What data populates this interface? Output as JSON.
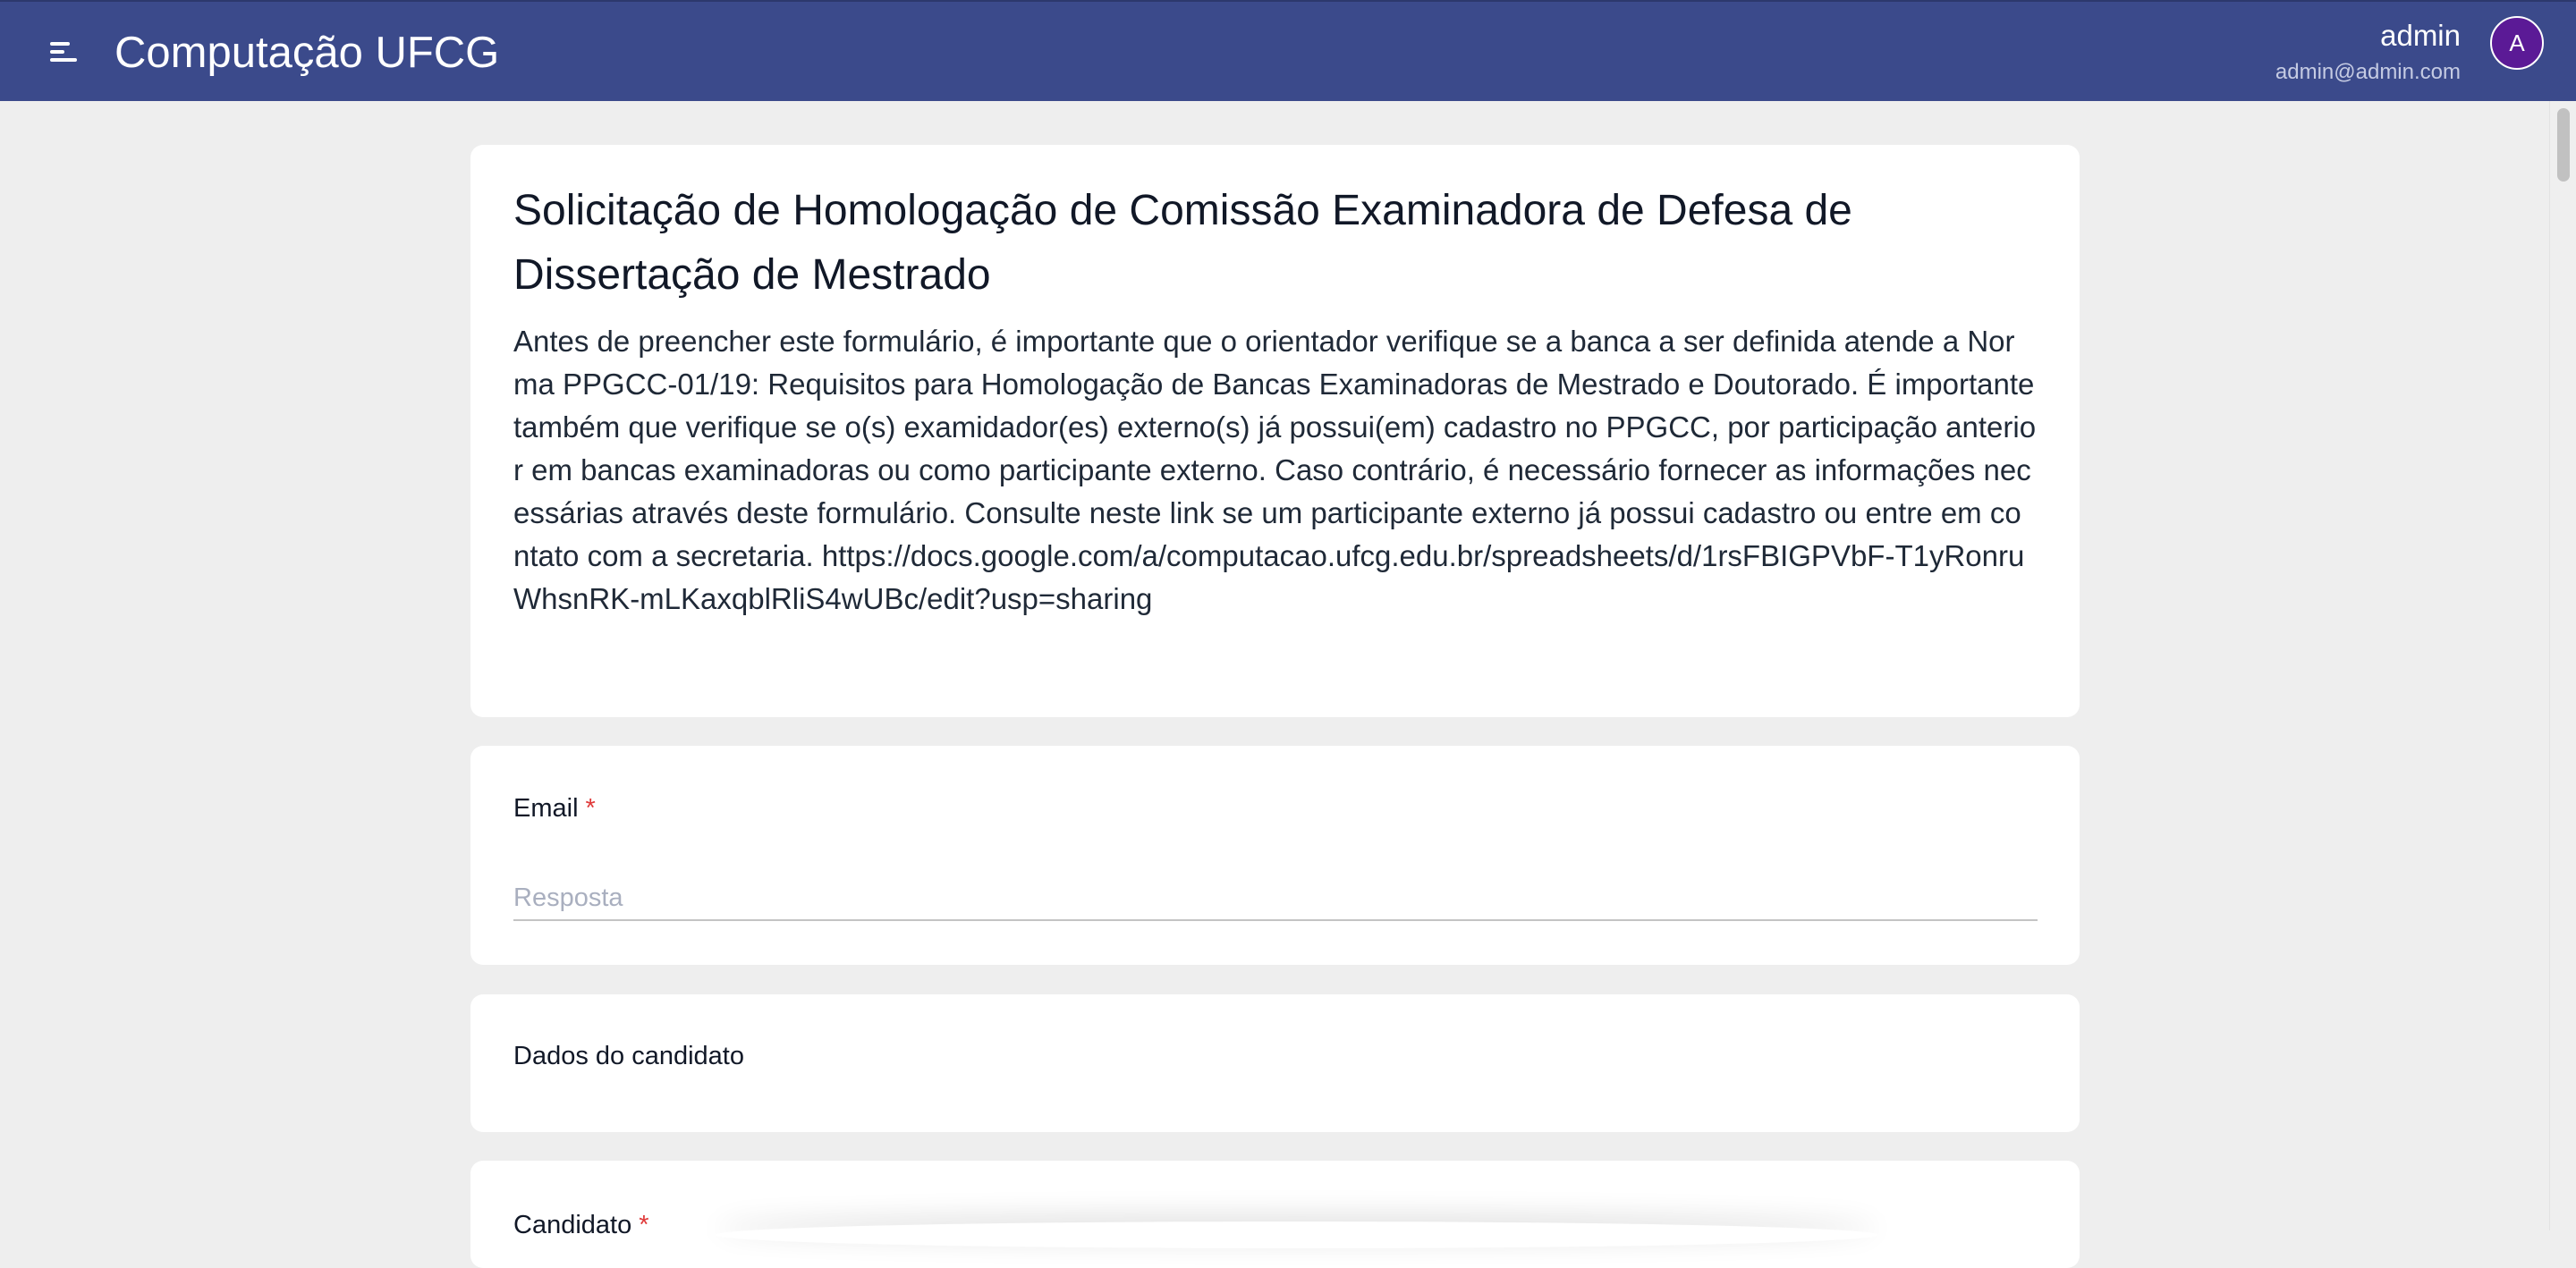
{
  "header": {
    "menu_icon": "menu-icon",
    "title": "Computação UFCG",
    "user_name": "admin",
    "user_email": "admin@admin.com",
    "avatar_initial": "A",
    "bar_color": "#3b4a8b",
    "avatar_color": "#5b1a96"
  },
  "form": {
    "title": "Solicitação de Homologação de Comissão Examinadora de Defesa de Dissertação de Mestrado",
    "description": "Antes de preencher este formulário, é importante que o orientador verifique se a banca a ser definida atende a Norma PPGCC-01/19: Requisitos para Homologação de Bancas Examinadoras de Mestrado e Doutorado. É importante também que verifique se o(s) examidador(es) externo(s) já possui(em) cadastro no PPGCC, por participação anterior em bancas examinadoras ou como participante externo. Caso contrário, é necessário fornecer as informações necessárias através deste formulário. Consulte neste link se um participante externo já possui cadastro ou entre em contato com a secretaria. https://docs.google.com/a/computacao.ufcg.edu.br/spreadsheets/d/1rsFBIGPVbF-T1yRonruWhsnRK-mLKaxqblRliS4wUBc/edit?usp=sharing"
  },
  "questions": [
    {
      "label": "Email",
      "required_mark": "*",
      "placeholder": "Resposta",
      "value": ""
    },
    {
      "label": "Dados do candidato"
    },
    {
      "label": "Candidato",
      "required_mark": "*"
    }
  ]
}
